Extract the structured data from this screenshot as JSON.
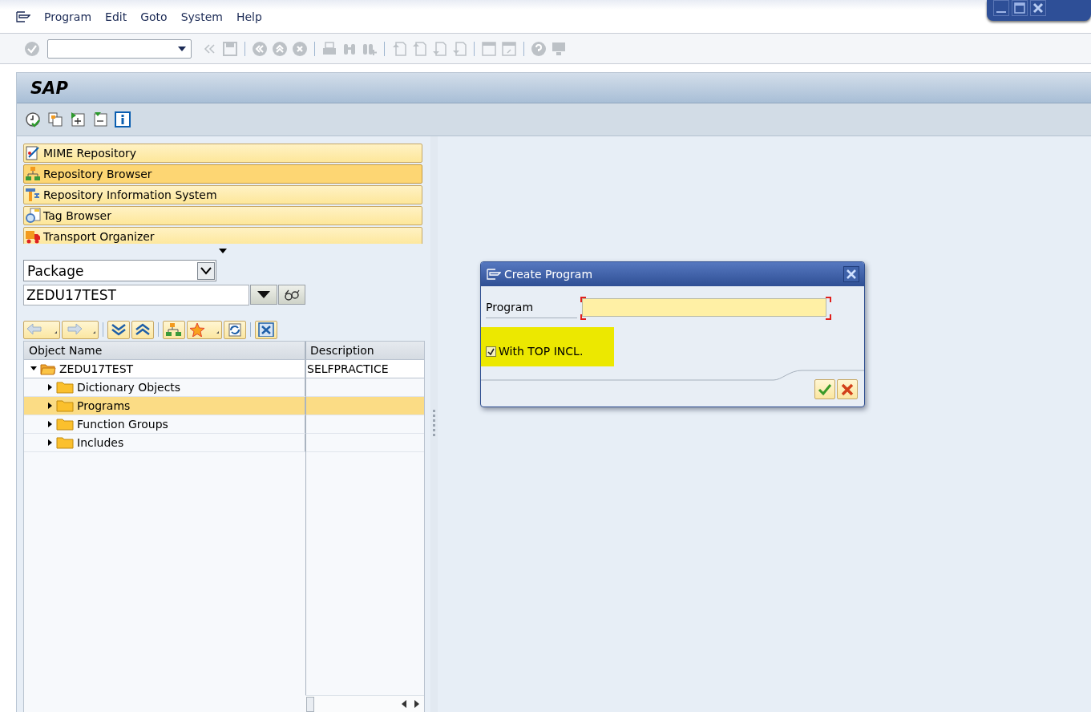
{
  "menu_bar": {
    "items": [
      "Program",
      "Edit",
      "Goto",
      "System",
      "Help"
    ]
  },
  "title": "SAP",
  "navigation": [
    {
      "label": "MIME Repository",
      "selected": false
    },
    {
      "label": "Repository Browser",
      "selected": true
    },
    {
      "label": "Repository Information System",
      "selected": false
    },
    {
      "label": "Tag Browser",
      "selected": false
    },
    {
      "label": "Transport Organizer",
      "selected": false
    }
  ],
  "object_selector": {
    "type": "Package",
    "value": "ZEDU17TEST"
  },
  "tree": {
    "columns": [
      "Object Name",
      "Description"
    ],
    "rows": [
      {
        "name": "ZEDU17TEST",
        "description": "SELFPRACTICE",
        "expanded": true,
        "selected": false,
        "children": [
          {
            "name": "Dictionary Objects",
            "expanded": false,
            "selected": false
          },
          {
            "name": "Programs",
            "expanded": false,
            "selected": true
          },
          {
            "name": "Function Groups",
            "expanded": false,
            "selected": false
          },
          {
            "name": "Includes",
            "expanded": false,
            "selected": false
          }
        ]
      }
    ]
  },
  "dialog": {
    "title": "Create Program",
    "field_label": "Program",
    "checkbox": {
      "label": "With TOP INCL.",
      "checked": true,
      "highlighted": true
    }
  }
}
